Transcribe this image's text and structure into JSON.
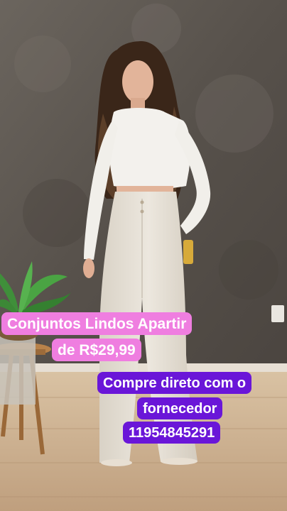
{
  "overlay": {
    "headline_line1": "Conjuntos Lindos Apartir",
    "headline_line2": "de R$29,99",
    "contact_line1": "Compre direto com o",
    "contact_line2": "fornecedor",
    "contact_line3": "11954845291"
  },
  "colors": {
    "headline_bg": "#ef7ee0",
    "contact_bg": "#6a16d8",
    "caption_text": "#ffffff"
  }
}
